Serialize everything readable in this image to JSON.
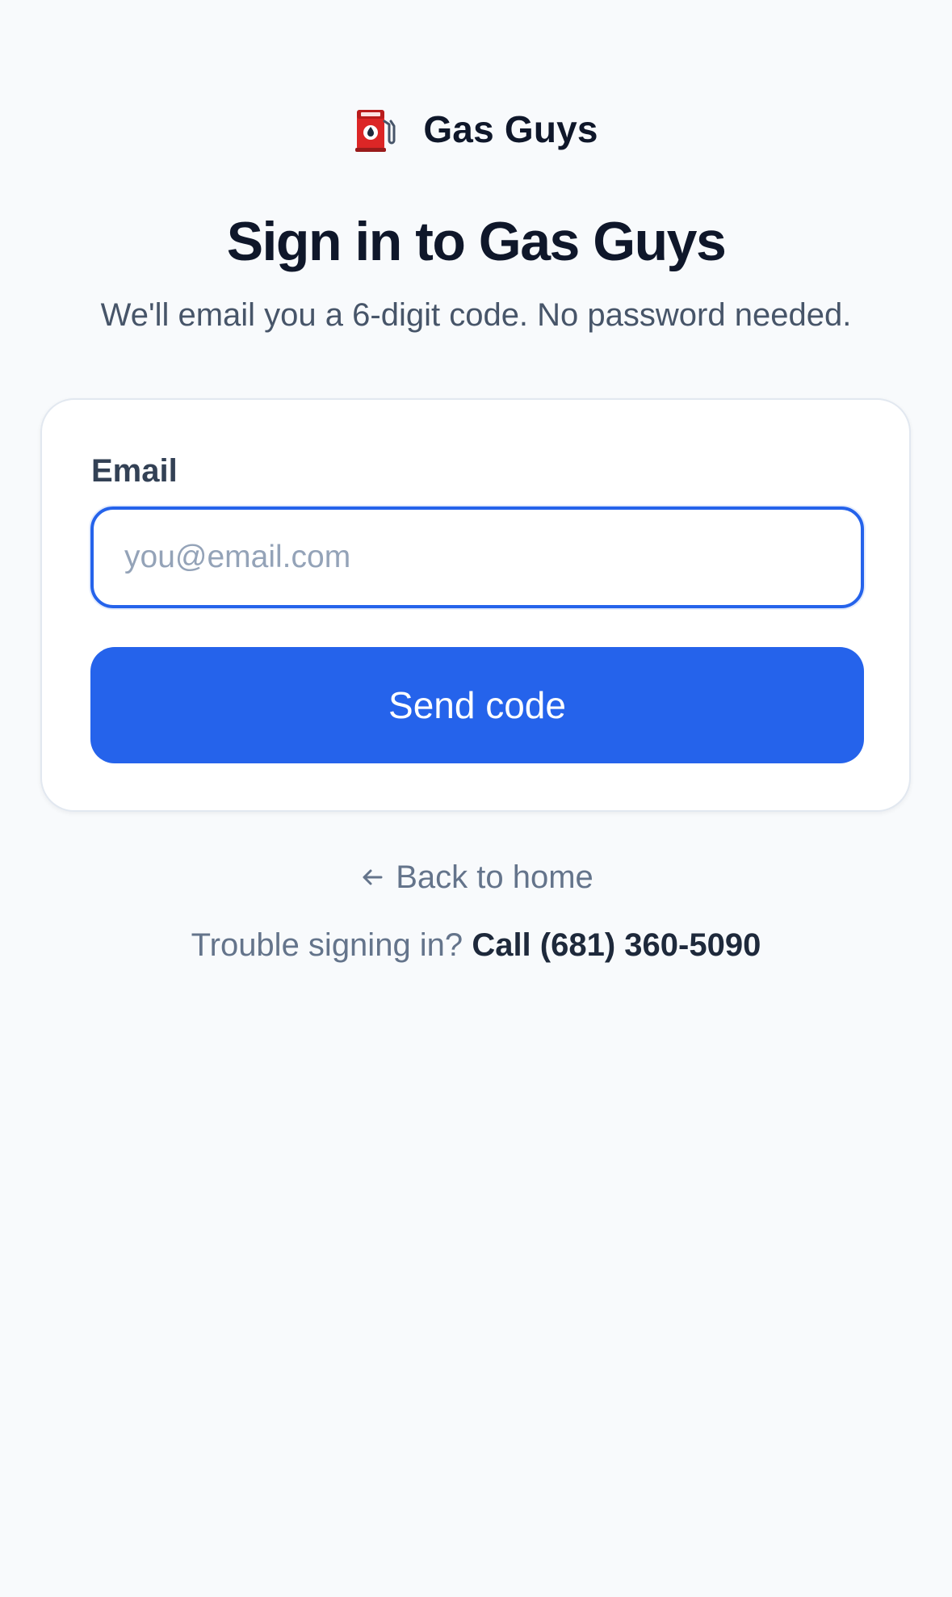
{
  "brand": {
    "name": "Gas Guys",
    "icon": "fuel-pump-icon"
  },
  "heading": {
    "title": "Sign in to Gas Guys",
    "subtitle": "We'll email you a 6-digit code. No password needed."
  },
  "form": {
    "email_label": "Email",
    "email_placeholder": "you@email.com",
    "email_value": "",
    "submit_label": "Send code"
  },
  "footer": {
    "back_arrow": "←",
    "back_label": "Back to home",
    "help_text": "Trouble signing in?",
    "help_phone": "Call (681) 360-5090"
  },
  "colors": {
    "accent": "#2563eb",
    "background": "#f8fafc",
    "pump_red": "#dc2626"
  }
}
